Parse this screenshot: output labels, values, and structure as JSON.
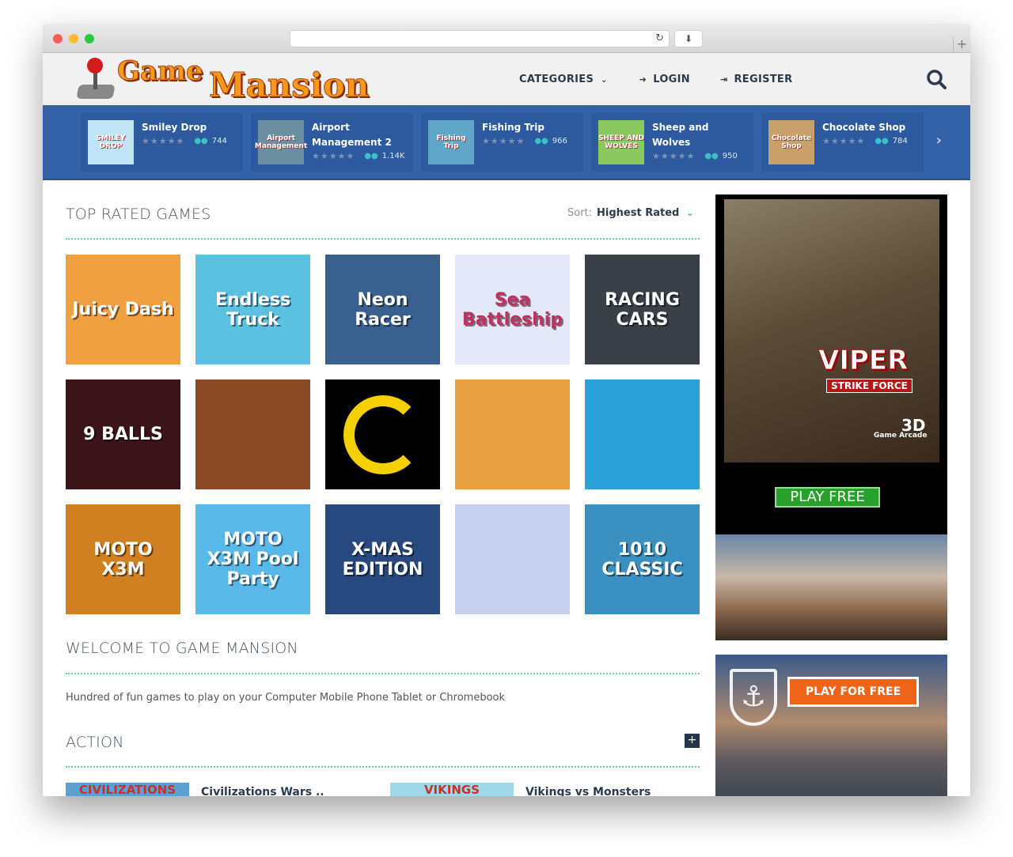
{
  "browser": {
    "reload_icon": "reload-icon",
    "download_icon": "download-icon",
    "new_tab": "+"
  },
  "logo": {
    "line1": "Game",
    "line2": "Mansion"
  },
  "nav": {
    "categories": "CATEGORIES",
    "login": "LOGIN",
    "register": "REGISTER"
  },
  "featured": [
    {
      "title": "Smiley Drop",
      "plays": "744",
      "art": "SMILEY DROP",
      "color": "#bfe4f5"
    },
    {
      "title": "Airport Management 2",
      "plays": "1.14K",
      "art": "Airport Management",
      "color": "#6b8fa0"
    },
    {
      "title": "Fishing Trip",
      "plays": "966",
      "art": "Fishing Trip",
      "color": "#5fa6c8"
    },
    {
      "title": "Sheep and Wolves",
      "plays": "950",
      "art": "SHEEP AND WOLVES",
      "color": "#8cc860"
    },
    {
      "title": "Chocolate Shop",
      "plays": "784",
      "art": "Chocolate Shop",
      "color": "#c9a06a"
    }
  ],
  "stars": "★★★★★",
  "top_rated": {
    "title": "TOP RATED GAMES",
    "sort_label": "Sort:",
    "sort_value": "Highest Rated",
    "games": [
      {
        "art": "Juicy Dash",
        "color": "#f0a040"
      },
      {
        "art": "Endless Truck",
        "color": "#5cc0e0"
      },
      {
        "art": "Neon Racer",
        "color": "#3a6090"
      },
      {
        "art": "Sea Battleship",
        "color": "#e4e8f8"
      },
      {
        "art": "RACING CARS",
        "color": "#3a4048"
      },
      {
        "art": "9 BALLS",
        "color": "#3a1418"
      },
      {
        "art": "",
        "color": "#8a4a26"
      },
      {
        "art": "",
        "color": "#000000"
      },
      {
        "art": "",
        "color": "#e8a040"
      },
      {
        "art": "",
        "color": "#2aa0d8"
      },
      {
        "art": "MOTO X3M",
        "color": "#d08020"
      },
      {
        "art": "MOTO X3M Pool Party",
        "color": "#58b8e8"
      },
      {
        "art": "X-MAS EDITION",
        "color": "#284880"
      },
      {
        "art": "",
        "color": "#c8d0f0"
      },
      {
        "art": "1010 CLASSIC",
        "color": "#3a90c0"
      }
    ]
  },
  "welcome": {
    "title": "WELCOME TO GAME MANSION",
    "text": "Hundred of fun games to play on your Computer Mobile Phone Tablet or Chromebook"
  },
  "action": {
    "title": "ACTION",
    "add": "+",
    "items": [
      {
        "title": "Civilizations Wars ..",
        "art": "CIVILIZATIONS"
      },
      {
        "title": "Vikings vs Monsters",
        "art": "VIKINGS"
      }
    ]
  },
  "ads": {
    "viper": {
      "title": "VIPER",
      "subtitle": "STRIKE FORCE",
      "brand_3d": "3D",
      "brand": "Game Arcade",
      "cta": "PLAY FREE"
    },
    "ships": {
      "cta": "PLAY FOR FREE"
    }
  }
}
